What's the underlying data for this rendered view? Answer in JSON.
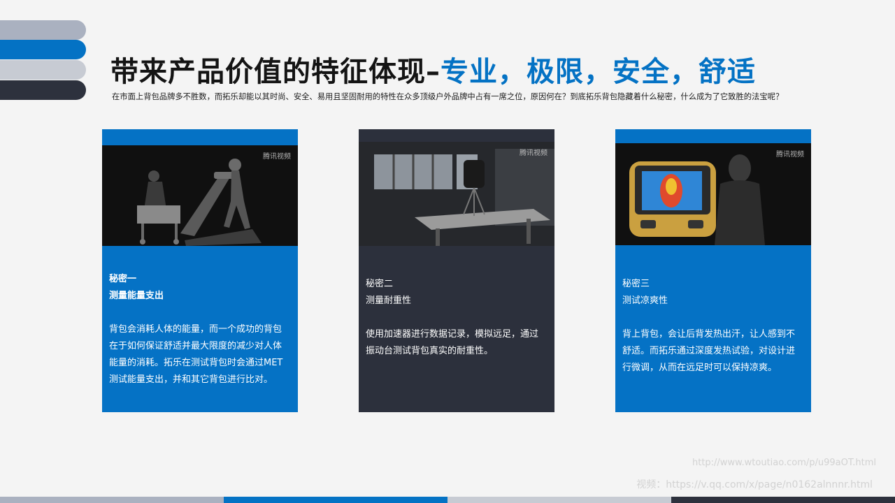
{
  "title": {
    "main": "带来产品价值的特征体现–",
    "accent": "专业，极限，安全，舒适"
  },
  "subtitle": "在市面上背包品牌多不胜数，而拓乐却能以其时尚、安全、易用且坚固耐用的特性在众多顶级户外品牌中占有一席之位，原因何在？到底拓乐背包隐藏着什么秘密，什么成为了它致胜的法宝呢？",
  "cards": [
    {
      "label": "秘密一",
      "heading": "测量能量支出",
      "body": "背包会消耗人体的能量，而一个成功的背包在于如何保证舒适并最大限度的减少对人体能量的消耗。拓乐在测试背包时会通过MET测试能量支出，并和其它背包进行比对。",
      "watermark": "腾讯视频"
    },
    {
      "label": "秘密二",
      "heading": "测量耐重性",
      "body": "使用加速器进行数据记录，模拟远足，通过振动台测试背包真实的耐重性。",
      "watermark": "腾讯视频"
    },
    {
      "label": "秘密三",
      "heading": "测试凉爽性",
      "body": "背上背包，会让后背发热出汗，让人感到不舒适。而拓乐通过深度发热试验，对设计进行微调，从而在远足时可以保持凉爽。",
      "watermark": "腾讯视频"
    }
  ],
  "footer": {
    "url1": "http://www.wtoutiao.com/p/u99aOT.html",
    "url2": "视频：https://v.qq.com/x/page/n0162alnnnr.html"
  },
  "colors": {
    "accent_blue": "#0472c4",
    "dark_slate": "#2d313d",
    "light_slate": "#aab1c0",
    "pale_slate": "#c7cbd3"
  }
}
